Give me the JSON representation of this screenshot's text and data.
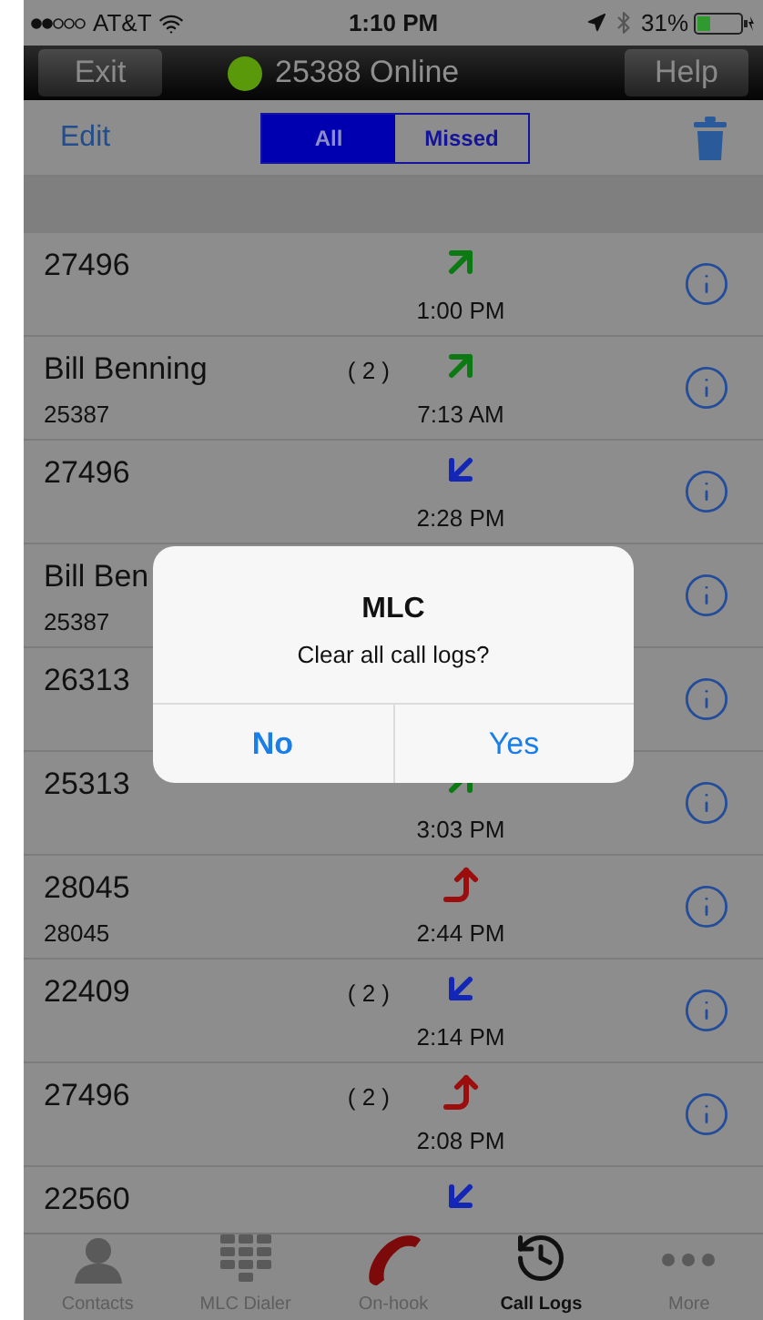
{
  "status_bar": {
    "carrier": "AT&T",
    "time": "1:10 PM",
    "battery": "31%"
  },
  "nav_bar": {
    "left_button": "Exit",
    "title": "25388 Online",
    "online": true,
    "right_button": "Help"
  },
  "toolbar": {
    "edit": "Edit",
    "segments": [
      {
        "label": "All",
        "selected": true
      },
      {
        "label": "Missed",
        "selected": false
      }
    ]
  },
  "calls": [
    {
      "name": "27496",
      "kind": "outgoing",
      "time": "1:00 PM",
      "info_button": true
    },
    {
      "name": "Bill Benning",
      "count": "( 2 )",
      "kind": "outgoing",
      "time": "7:13 AM",
      "number": "25387",
      "info_button": true
    },
    {
      "name": "27496",
      "kind": "incoming",
      "time": "2:28 PM",
      "info_button": true
    },
    {
      "name": "Bill Ben",
      "number": "25387",
      "info_button": true
    },
    {
      "name": "26313",
      "info_button": true
    },
    {
      "name": "25313",
      "kind": "outgoing",
      "time": "3:03 PM",
      "info_button": true
    },
    {
      "name": "28045",
      "kind": "unanswered",
      "time": "2:44 PM",
      "number": "28045",
      "info_button": true
    },
    {
      "name": "22409",
      "count": "( 2 )",
      "kind": "incoming",
      "time": "2:14 PM",
      "info_button": true
    },
    {
      "name": "27496",
      "count": "( 2 )",
      "kind": "unanswered",
      "time": "2:08 PM",
      "info_button": true
    },
    {
      "name": "22560",
      "kind": "incoming",
      "info_button": false
    }
  ],
  "alert": {
    "title": "MLC",
    "message": "Clear all call logs?",
    "buttons": [
      {
        "label": "No",
        "bold": true
      },
      {
        "label": "Yes",
        "bold": false
      }
    ]
  },
  "tab_bar": [
    {
      "label": "Contacts",
      "kind": "contacts",
      "selected": false
    },
    {
      "label": "MLC Dialer",
      "kind": "dialer",
      "selected": false
    },
    {
      "label": "On-hook",
      "kind": "phone",
      "selected": false
    },
    {
      "label": "Call Logs",
      "kind": "history",
      "selected": true
    },
    {
      "label": "More",
      "kind": "more",
      "selected": false
    }
  ]
}
